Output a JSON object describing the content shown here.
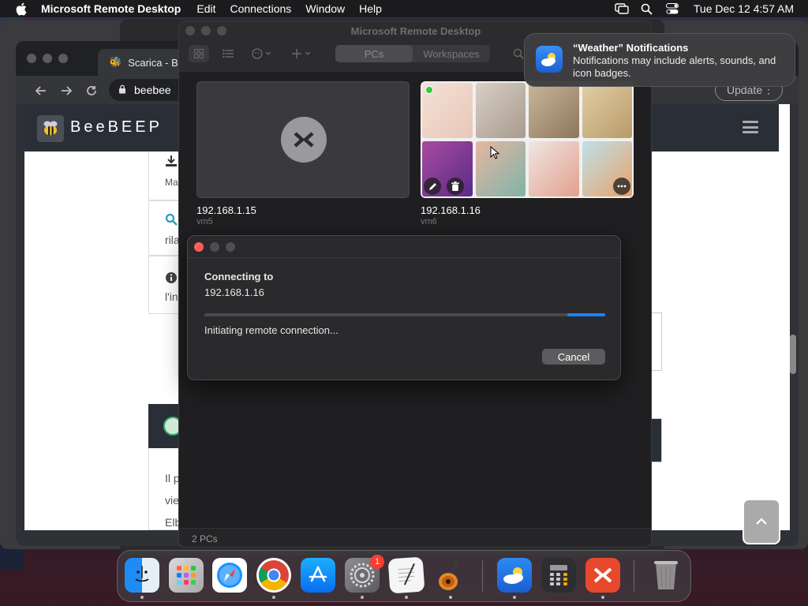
{
  "menubar": {
    "app_name": "Microsoft Remote Desktop",
    "items": [
      "Edit",
      "Connections",
      "Window",
      "Help"
    ],
    "clock": "Tue Dec 12  4:57 AM"
  },
  "browser": {
    "tab_title": "Scarica - Be",
    "url_text": "beebee",
    "update_label": "Update",
    "site_title": "BeeBEEP",
    "left_snippets": [
      "Ma",
      "rila",
      "l'in",
      "Il p",
      "vie",
      "Elb"
    ]
  },
  "remote_desktop": {
    "window_title": "Microsoft Remote Desktop",
    "tabs": [
      "PCs",
      "Workspaces"
    ],
    "active_tab": "PCs",
    "pcs": [
      {
        "name": "192.168.1.15",
        "user": "vm5"
      },
      {
        "name": "192.168.1.16",
        "user": "vm6"
      }
    ],
    "footer": "2 PCs"
  },
  "dialog": {
    "heading": "Connecting to",
    "host": "192.168.1.16",
    "status": "Initiating remote connection...",
    "cancel_label": "Cancel"
  },
  "notification": {
    "title": "“Weather” Notifications",
    "body": "Notifications may include alerts, sounds, and icon badges."
  },
  "dock": {
    "apps": [
      "finder",
      "launchpad",
      "safari",
      "chrome",
      "app-store",
      "system-settings",
      "textedit",
      "garageband",
      "weather",
      "calculator",
      "remote-desktop",
      "trash"
    ],
    "settings_badge": "1"
  },
  "colors": {
    "accent": "#1a84ff",
    "close": "#ff5f57",
    "badge": "#ff3b30"
  }
}
